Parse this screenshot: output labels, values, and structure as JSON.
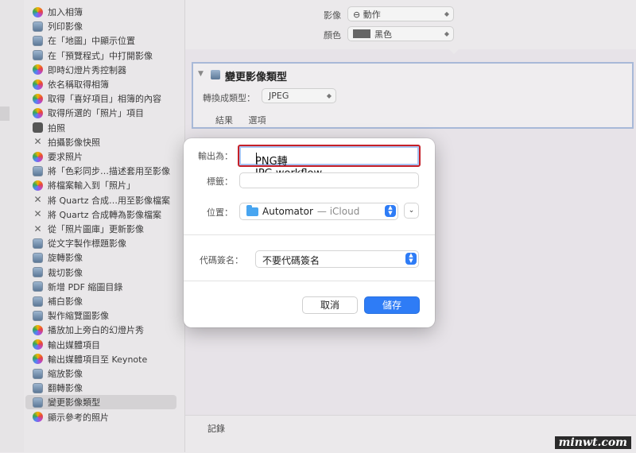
{
  "sidebar": {
    "actions": [
      {
        "label": "加入相簿",
        "icon": "photos-icon",
        "selected": false
      },
      {
        "label": "列印影像",
        "icon": "preview-icon",
        "selected": false
      },
      {
        "label": "在「地圖」中顯示位置",
        "icon": "preview-icon",
        "selected": false
      },
      {
        "label": "在「預覽程式」中打開影像",
        "icon": "preview-icon",
        "selected": false
      },
      {
        "label": "即時幻燈片秀控制器",
        "icon": "photos-icon",
        "selected": false
      },
      {
        "label": "依名稱取得相簿",
        "icon": "photos-icon",
        "selected": false
      },
      {
        "label": "取得「喜好項目」相簿的內容",
        "icon": "photos-icon",
        "selected": false
      },
      {
        "label": "取得所選的「照片」項目",
        "icon": "photos-icon",
        "selected": false
      },
      {
        "label": "拍照",
        "icon": "camera-icon",
        "selected": false
      },
      {
        "label": "拍攝影像快照",
        "icon": "tool-icon",
        "selected": false
      },
      {
        "label": "要求照片",
        "icon": "photos-icon",
        "selected": false
      },
      {
        "label": "將「色彩同步…描述套用至影像",
        "icon": "preview-icon",
        "selected": false
      },
      {
        "label": "將檔案輸入到「照片」",
        "icon": "photos-icon",
        "selected": false
      },
      {
        "label": "將 Quartz 合成…用至影像檔案",
        "icon": "tool-icon",
        "selected": false
      },
      {
        "label": "將 Quartz 合成轉為影像檔案",
        "icon": "tool-icon",
        "selected": false
      },
      {
        "label": "從「照片圖庫」更新影像",
        "icon": "tool-icon",
        "selected": false
      },
      {
        "label": "從文字製作標題影像",
        "icon": "preview-icon",
        "selected": false
      },
      {
        "label": "旋轉影像",
        "icon": "preview-icon",
        "selected": false
      },
      {
        "label": "裁切影像",
        "icon": "preview-icon",
        "selected": false
      },
      {
        "label": "新增 PDF 縮圖目錄",
        "icon": "preview-icon",
        "selected": false
      },
      {
        "label": "補白影像",
        "icon": "preview-icon",
        "selected": false
      },
      {
        "label": "製作縮覽圖影像",
        "icon": "preview-icon",
        "selected": false
      },
      {
        "label": "播放加上旁白的幻燈片秀",
        "icon": "photos-icon",
        "selected": false
      },
      {
        "label": "輸出媒體項目",
        "icon": "photos-icon",
        "selected": false
      },
      {
        "label": "輸出媒體項目至 Keynote",
        "icon": "photos-icon",
        "selected": false
      },
      {
        "label": "縮放影像",
        "icon": "preview-icon",
        "selected": false
      },
      {
        "label": "翻轉影像",
        "icon": "preview-icon",
        "selected": false
      },
      {
        "label": "變更影像類型",
        "icon": "preview-icon",
        "selected": true
      },
      {
        "label": "顯示參考的照片",
        "icon": "photos-icon",
        "selected": false
      }
    ]
  },
  "workflow": {
    "prev_action": {
      "image_label": "影像",
      "image_value": "⊖ 動作",
      "color_label": "顏色",
      "color_value": "黑色"
    },
    "change_type": {
      "title": "變更影像類型",
      "convert_label": "轉換成類型：",
      "convert_value": "JPEG",
      "tabs": [
        "結果",
        "選項"
      ]
    },
    "log_label": "記錄"
  },
  "save_dialog": {
    "export_as_label": "輸出為：",
    "filename": "PNG轉 JPG.workflow",
    "tags_label": "標籤：",
    "tags_value": "",
    "location_label": "位置：",
    "location_value": "Automator",
    "location_sub": "— iCloud",
    "code_sign_label": "代碼簽名：",
    "code_sign_value": "不要代碼簽名",
    "cancel_label": "取消",
    "save_label": "儲存",
    "accent_color": "#2e7cf6",
    "highlight_color": "#c62028"
  },
  "watermark": "minwt.com"
}
